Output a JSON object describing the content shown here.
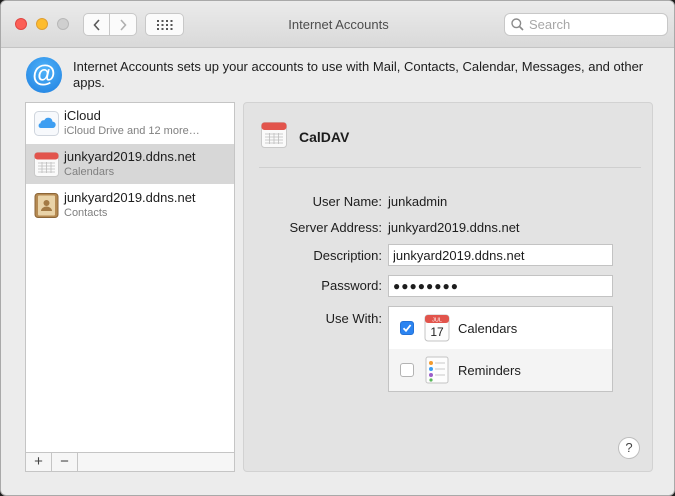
{
  "window": {
    "title": "Internet Accounts"
  },
  "search": {
    "placeholder": "Search"
  },
  "header": {
    "description": "Internet Accounts sets up your accounts to use with Mail, Contacts, Calendar, Messages, and other apps."
  },
  "accounts": [
    {
      "name": "iCloud",
      "detail": "iCloud Drive and 12 more…",
      "icon": "icloud-icon",
      "selected": false
    },
    {
      "name": "junkyard2019.ddns.net",
      "detail": "Calendars",
      "icon": "calendar-icon",
      "selected": true
    },
    {
      "name": "junkyard2019.ddns.net",
      "detail": "Contacts",
      "icon": "contacts-icon",
      "selected": false
    }
  ],
  "list_bar": {
    "add": "+",
    "remove": "−"
  },
  "detail": {
    "title": "CalDAV",
    "user_name_label": "User Name:",
    "user_name": "junkadmin",
    "server_label": "Server Address:",
    "server": "junkyard2019.ddns.net",
    "description_label": "Description:",
    "description": "junkyard2019.ddns.net",
    "password_label": "Password:",
    "password": "●●●●●●●●",
    "use_with_label": "Use With:",
    "use_with": [
      {
        "label": "Calendars",
        "checked": true,
        "icon_text_month": "JUL",
        "icon_text_day": "17"
      },
      {
        "label": "Reminders",
        "checked": false
      }
    ],
    "help": "?"
  },
  "colors": {
    "accent": "#2b84f1",
    "selection": "#d7d7d7"
  }
}
